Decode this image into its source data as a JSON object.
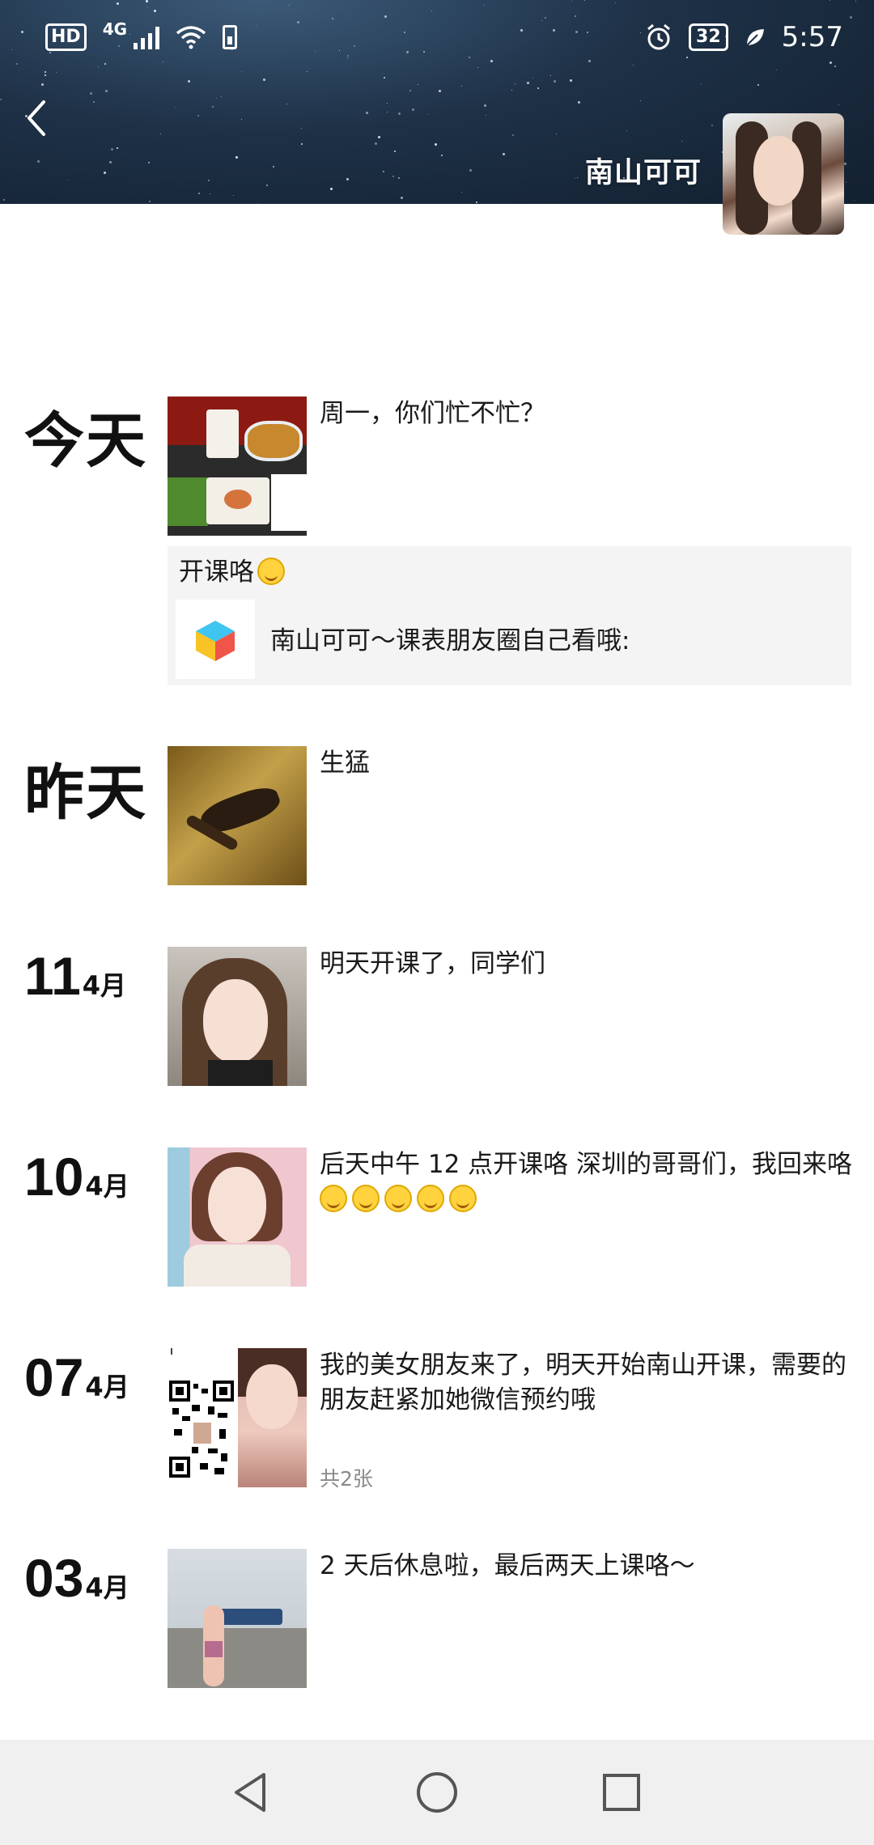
{
  "status_bar": {
    "hd": "HD",
    "network": "4G",
    "battery": "32",
    "time": "5:57"
  },
  "header": {
    "name": "南山可可"
  },
  "posts": [
    {
      "date": "今天",
      "text": "周一，你们忙不忙？"
    },
    {
      "date": "昨天",
      "text": "生猛"
    },
    {
      "day": "11",
      "month": "4月",
      "text": "明天开课了，同学们"
    },
    {
      "day": "10",
      "month": "4月",
      "text": "后天中午 12 点开课咯 深圳的哥哥们，我回来咯"
    },
    {
      "day": "07",
      "month": "4月",
      "text": "我的美女朋友来了，明天开始南山开课，需要的朋友赶紧加她微信预约哦",
      "count": "共2张"
    },
    {
      "day": "03",
      "month": "4月",
      "text": "2 天后休息啦，最后两天上课咯～"
    }
  ],
  "share": {
    "title": "开课咯",
    "subtitle": "南山可可～课表朋友圈自己看哦:",
    "icon": "cube-app-icon"
  },
  "colors": {
    "cover_dark": "#1e3147",
    "share_bg": "#f4f4f4",
    "navbar_bg": "#f0f0f0"
  }
}
